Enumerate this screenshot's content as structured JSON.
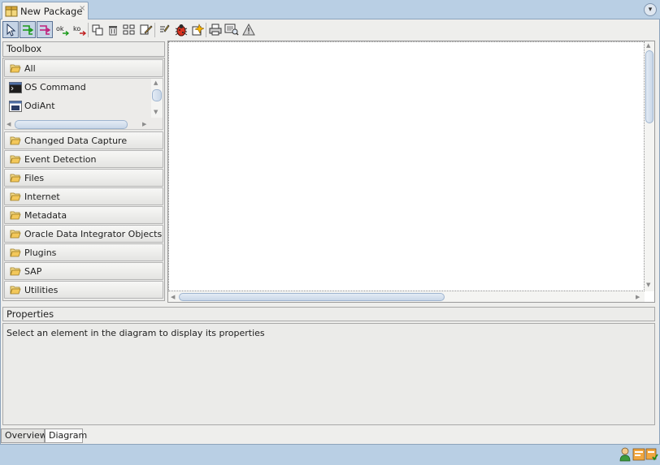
{
  "document_tab": {
    "title": "New Package",
    "close_glyph": "×",
    "icon": "package-icon"
  },
  "toolbar": {
    "buttons": [
      {
        "name": "select-tool-icon"
      },
      {
        "name": "next-step-ok-icon"
      },
      {
        "name": "next-step-ko-icon"
      },
      {
        "name": "ok-link-icon",
        "label": "ok"
      },
      {
        "name": "ko-link-icon",
        "label": "ko"
      },
      {
        "name": "duplicate-icon"
      },
      {
        "name": "delete-icon"
      },
      {
        "name": "arrange-icon"
      },
      {
        "name": "edit-icon"
      },
      {
        "name": "validate-icon"
      },
      {
        "name": "debug-bug-icon"
      },
      {
        "name": "execute-icon"
      },
      {
        "name": "print-icon"
      },
      {
        "name": "print-preview-icon"
      },
      {
        "name": "warning-icon"
      }
    ]
  },
  "toolbox": {
    "title": "Toolbox",
    "categories": [
      "All",
      "Changed Data Capture",
      "Event Detection",
      "Files",
      "Internet",
      "Metadata",
      "Oracle Data Integrator Objects",
      "Plugins",
      "SAP",
      "Utilities"
    ],
    "all_items": [
      {
        "label": "OS Command",
        "icon": "os-command-icon"
      },
      {
        "label": "OdiAnt",
        "icon": "odiant-icon"
      }
    ]
  },
  "properties": {
    "title": "Properties",
    "message": "Select an element in the diagram to display its properties"
  },
  "bottom_tabs": [
    "Overview",
    "Diagram"
  ],
  "colors": {
    "chrome_blue": "#b9cfe4",
    "panel_grey": "#eeeeec",
    "folder_yellow": "#f3c85a"
  }
}
